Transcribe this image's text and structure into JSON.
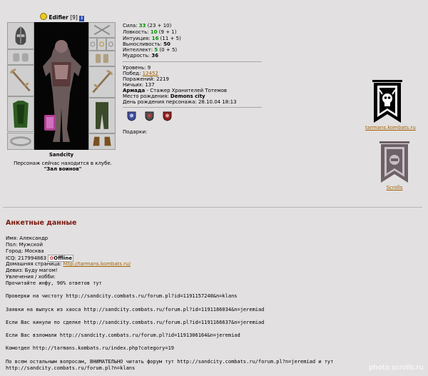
{
  "character": {
    "name": "Edifier",
    "level_tag": "[9]",
    "info_badge": "i",
    "location_name": "Sandcity",
    "location_note": "Персонаж сейчас находится в клубе.",
    "room": "\"Зал воинов\""
  },
  "stats": [
    {
      "label": "Сила: ",
      "value": "33",
      "extra": " (23 + 10)"
    },
    {
      "label": "Ловкость: ",
      "value": "10",
      "extra": " (9 + 1)"
    },
    {
      "label": "Интуиция: ",
      "value": "16",
      "extra": " (11 + 5)"
    },
    {
      "label": "Выносливость: ",
      "value": "50",
      "extra": ""
    },
    {
      "label": "Интеллект: ",
      "value": "5",
      "extra": " (0 + 5)"
    },
    {
      "label": "Мудрость: ",
      "value": "36",
      "extra": ""
    }
  ],
  "info": {
    "level": "Уровень: 9",
    "wins_label": "Побед: ",
    "wins_value": "12452",
    "losses": "Поражений: 2219",
    "draws": "Ничьих: 137",
    "army_label": "Армада",
    "army_rank": " - Стажер Хранителей Тотемов",
    "birthplace_label": "Место рождения: ",
    "birthplace_value": "Demons city",
    "birthday": "День рождения персонажа: 28.10.04 18:13",
    "gifts": "Подарки:"
  },
  "banners": [
    {
      "link": "tarmans.kombats.ru",
      "color": "#000000"
    },
    {
      "link": "Scrolls",
      "color": "#6e6068"
    }
  ],
  "profile": {
    "heading": "Анкетные данные",
    "name": "Имя: Александр",
    "gender": "Пол: Мужской",
    "city": "Город: Москва",
    "icq": "ICQ: 217994863",
    "icq_status": "Offline",
    "homepage_label": "Домашняя страница: ",
    "homepage_link": "http://tarmans.kombats.ru/",
    "motto": "Девиз: Буду магом!",
    "hobby_label": "Увлечения / хобби:",
    "hobby_lines": [
      "Прочитайте инфу, 90% ответов тут",
      "Проверки на чистоту http://sandcity.combats.ru/forum.pl?id=1191157240&n=klans",
      "Заявки на выпуск из хаоса http://sandcity.combats.ru/forum.pl?id=1191186034&n=jeremiad",
      "Если Вас кинули по сделке http://sandcity.combats.ru/forum.pl?id=1191166637&n=jeremiad",
      "Если Вас взломали http://sandcity.combats.ru/forum.pl?id=1191306164&n=jeremiad",
      "Комотдел http://tarmans.kombats.ru/index.php?category=19",
      "По всем остальным вопросам, ВНИМАТЕЛЬНО читать форум тут http://sandcity.combats.ru/forum.pl?n=jeremiad и тут",
      "http://sandcity.combats.ru/forum.pl?n=klans"
    ]
  },
  "watermark": "photo.scrolls.ru",
  "colors": {
    "background": "#e2e0e0",
    "heading": "#7a1a10",
    "stat_value": "#009000",
    "link": "#a06000"
  }
}
